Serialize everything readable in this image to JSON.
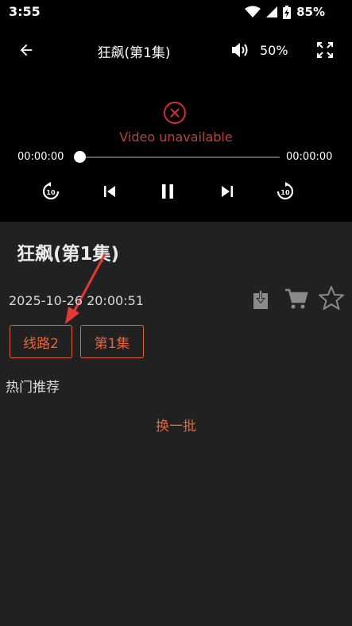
{
  "status_bar": {
    "time": "3:55",
    "battery": "85%",
    "icons": [
      "wifi-icon",
      "signal-icon",
      "battery-charging-icon"
    ]
  },
  "player": {
    "title": "狂飙(第1集)",
    "volume": "50%",
    "error_text": "Video unavailable",
    "time_current": "00:00:00",
    "time_total": "00:00:00",
    "progress": 0,
    "icons": [
      "back-arrow-icon",
      "volume-icon",
      "fullscreen-icon",
      "error-circle-icon",
      "replay-10-icon",
      "skip-previous-icon",
      "pause-icon",
      "skip-next-icon",
      "forward-10-icon"
    ]
  },
  "detail": {
    "title": "狂飙(第1集)",
    "date": "2025-10-26 20:00:51",
    "actions": [
      "download-icon",
      "cart-icon",
      "star-icon"
    ]
  },
  "chips": {
    "route": "线路2",
    "episode": "第1集"
  },
  "recommend": {
    "header": "热门推荐",
    "refresh": "换一批"
  },
  "colors": {
    "accent": "#e5643a",
    "background": "#212121",
    "player_bg": "#000000",
    "error": "#d32f2f",
    "annotation": "#e53935"
  }
}
